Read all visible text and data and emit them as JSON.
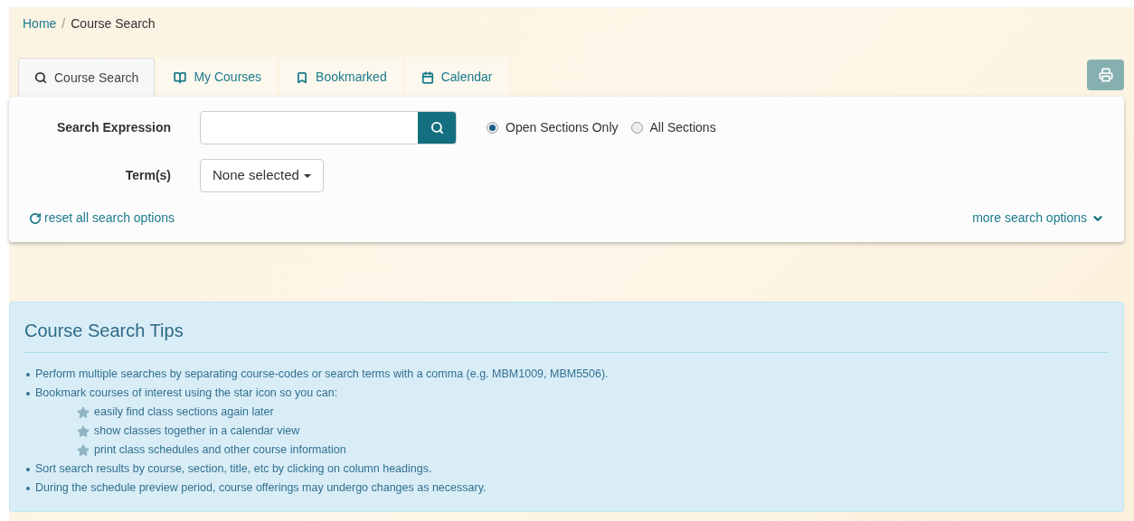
{
  "breadcrumb": [
    "Home",
    "Course Search"
  ],
  "breadcrumb_separator": "/",
  "tabs": [
    {
      "label": "Course Search",
      "kind": "search",
      "selected": true
    },
    {
      "label": "My Courses",
      "kind": "book",
      "selected": false
    },
    {
      "label": "Bookmarked",
      "kind": "bookmark",
      "selected": false
    },
    {
      "label": "Calendar",
      "kind": "calendar",
      "selected": false
    }
  ],
  "search": {
    "label": "Search Expression",
    "options": [
      {
        "label": "Open Sections Only",
        "selected": true
      },
      {
        "label": "All Sections",
        "selected": false
      }
    ]
  },
  "terms": {
    "label": "Term(s)",
    "value": "None selected"
  },
  "reset_link": "reset all search options",
  "more_link": "more search options",
  "tips": {
    "title": "Course Search Tips",
    "items": [
      {
        "text": "Perform multiple searches by separating course-codes or search terms with a comma (e.g. MBM1009, MBM5506)."
      },
      {
        "text": "Bookmark courses of interest using the star icon so you can:",
        "children": [
          {
            "text": "easily find class sections again later"
          },
          {
            "text": "show classes together in a calendar view"
          },
          {
            "text": "print class schedules and other course information"
          }
        ]
      },
      {
        "text": "Sort search results by course, section, title, etc by clicking on column headings."
      },
      {
        "text": "During the schedule preview period, course offerings may undergo changes as necessary."
      }
    ]
  }
}
